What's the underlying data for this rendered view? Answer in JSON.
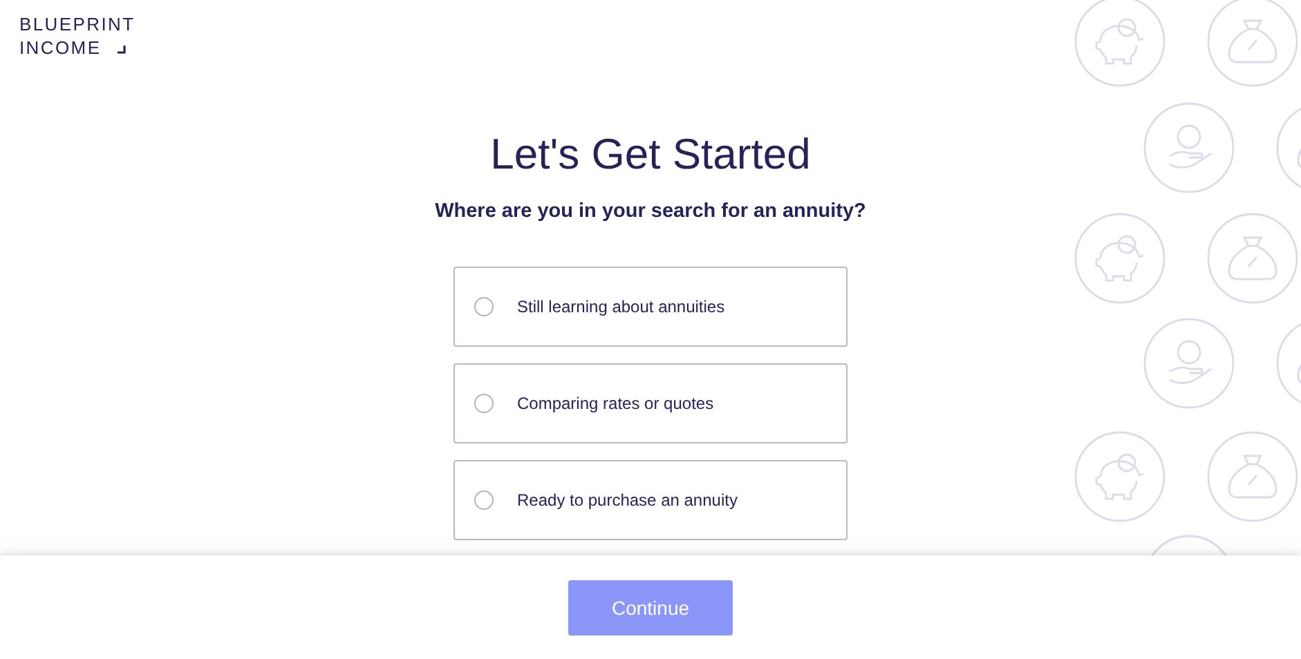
{
  "logo": {
    "lines": [
      "BLUEPRINT",
      "INCOME"
    ]
  },
  "title": "Let's Get Started",
  "question": "Where are you in your search for an annuity?",
  "options": [
    {
      "label": "Still learning about annuities",
      "selected": false
    },
    {
      "label": "Comparing rates or quotes",
      "selected": false
    },
    {
      "label": "Ready to purchase an annuity",
      "selected": false
    }
  ],
  "continue_button": {
    "label": "Continue",
    "disabled": true
  }
}
